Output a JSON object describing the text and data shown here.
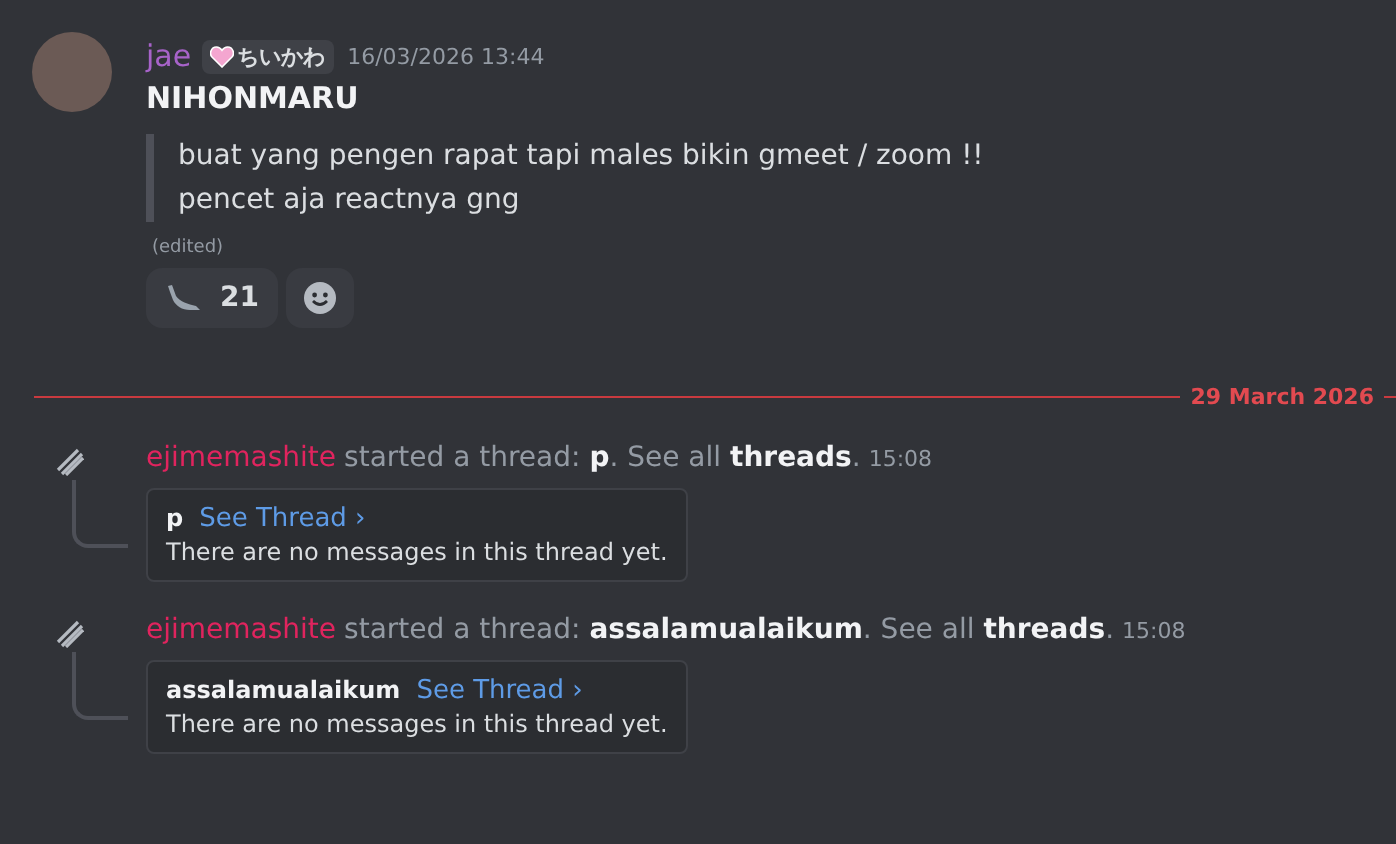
{
  "message": {
    "author": "jae",
    "tag": "ちいかわ",
    "timestamp": "16/03/2026 13:44",
    "title": "NIHONMARU",
    "quote": [
      "buat yang pengen rapat tapi males bikin gmeet / zoom !!",
      "pencet aja reactnya gng"
    ],
    "edited": "(edited)",
    "reactions": [
      {
        "kind": "emoji",
        "count": "21"
      },
      {
        "kind": "add"
      }
    ]
  },
  "date_divider": "29 March 2026",
  "threads": [
    {
      "user": "ejimemashite",
      "action": "started a thread: **p**. See all **threads**.",
      "time": "15:08",
      "name": "p",
      "link": "See Thread ›",
      "preview": "There are no messages in this thread yet."
    },
    {
      "user": "ejimemashite",
      "action": "started a thread: **assalamualaikum**. See all **threads**.",
      "time": "15:08",
      "name": "assalamualaikum",
      "link": "See Thread ›",
      "preview": "There are no messages in this thread yet."
    }
  ]
}
